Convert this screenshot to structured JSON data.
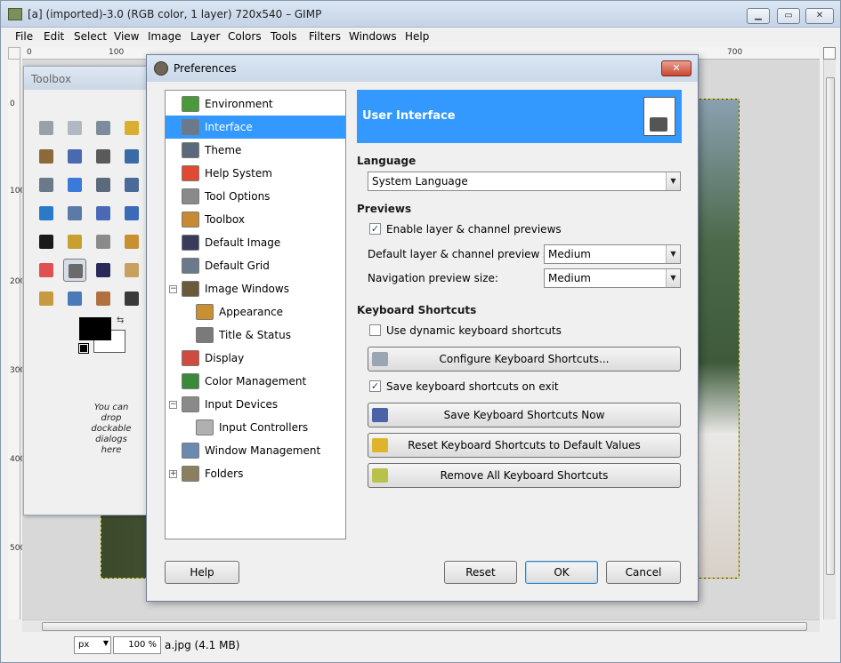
{
  "main_window": {
    "title": "[a] (imported)-3.0 (RGB color, 1 layer) 720x540 – GIMP",
    "menus": [
      "File",
      "Edit",
      "Select",
      "View",
      "Image",
      "Layer",
      "Colors",
      "Tools",
      "Filters",
      "Windows",
      "Help"
    ],
    "ruler_top_labels": [
      "0",
      "100",
      "700"
    ],
    "ruler_left_labels": [
      "0",
      "100",
      "200",
      "300",
      "400",
      "500"
    ],
    "status": {
      "unit": "px",
      "zoom": "100 %",
      "file_info": "a.jpg (4.1 MB)"
    }
  },
  "toolbox": {
    "title": "Toolbox",
    "drop_hint": "You can drop dockable dialogs here",
    "tools": [
      "rect-select-icon",
      "ellipse-select-icon",
      "free-select-icon",
      "fuzzy-select-icon",
      "scissors-icon",
      "foreground-select-icon",
      "paths-icon",
      "color-picker-icon",
      "measure-icon",
      "move-icon",
      "align-icon",
      "crop-icon",
      "scale-icon",
      "shear-icon",
      "perspective-icon",
      "flip-icon",
      "text-icon",
      "bucket-fill-icon",
      "blend-icon",
      "pencil-icon",
      "eraser-icon",
      "airbrush-icon",
      "ink-icon",
      "clone-icon",
      "heal-icon",
      "blur-icon",
      "smudge-icon",
      "dodge-burn-icon"
    ],
    "active_tool_index": 21,
    "fg_color": "#000000",
    "bg_color": "#ffffff"
  },
  "dialog": {
    "title": "Preferences",
    "close_label": "✕",
    "tree": [
      {
        "label": "Environment",
        "level": 0,
        "expander": ""
      },
      {
        "label": "Interface",
        "level": 0,
        "expander": "",
        "selected": true
      },
      {
        "label": "Theme",
        "level": 0,
        "expander": ""
      },
      {
        "label": "Help System",
        "level": 0,
        "expander": ""
      },
      {
        "label": "Tool Options",
        "level": 0,
        "expander": ""
      },
      {
        "label": "Toolbox",
        "level": 0,
        "expander": ""
      },
      {
        "label": "Default Image",
        "level": 0,
        "expander": ""
      },
      {
        "label": "Default Grid",
        "level": 0,
        "expander": ""
      },
      {
        "label": "Image Windows",
        "level": 0,
        "expander": "−"
      },
      {
        "label": "Appearance",
        "level": 1,
        "expander": ""
      },
      {
        "label": "Title & Status",
        "level": 1,
        "expander": ""
      },
      {
        "label": "Display",
        "level": 0,
        "expander": ""
      },
      {
        "label": "Color Management",
        "level": 0,
        "expander": ""
      },
      {
        "label": "Input Devices",
        "level": 0,
        "expander": "−"
      },
      {
        "label": "Input Controllers",
        "level": 1,
        "expander": ""
      },
      {
        "label": "Window Management",
        "level": 0,
        "expander": ""
      },
      {
        "label": "Folders",
        "level": 0,
        "expander": "+"
      }
    ],
    "banner_title": "User Interface",
    "language": {
      "heading": "Language",
      "value": "System Language"
    },
    "previews": {
      "heading": "Previews",
      "enable_label": "Enable layer & channel previews",
      "enable_checked": true,
      "default_size_label": "Default layer & channel preview size:",
      "default_size_value": "Medium",
      "nav_size_label": "Navigation preview size:",
      "nav_size_value": "Medium"
    },
    "shortcuts": {
      "heading": "Keyboard Shortcuts",
      "dynamic_label": "Use dynamic keyboard shortcuts",
      "dynamic_checked": false,
      "configure_label": "Configure Keyboard Shortcuts...",
      "save_on_exit_label": "Save keyboard shortcuts on exit",
      "save_on_exit_checked": true,
      "save_now_label": "Save Keyboard Shortcuts Now",
      "reset_label": "Reset Keyboard Shortcuts to Default Values",
      "remove_label": "Remove All Keyboard Shortcuts"
    },
    "buttons": {
      "help": "Help",
      "reset": "Reset",
      "ok": "OK",
      "cancel": "Cancel"
    },
    "check_mark": "✓"
  }
}
